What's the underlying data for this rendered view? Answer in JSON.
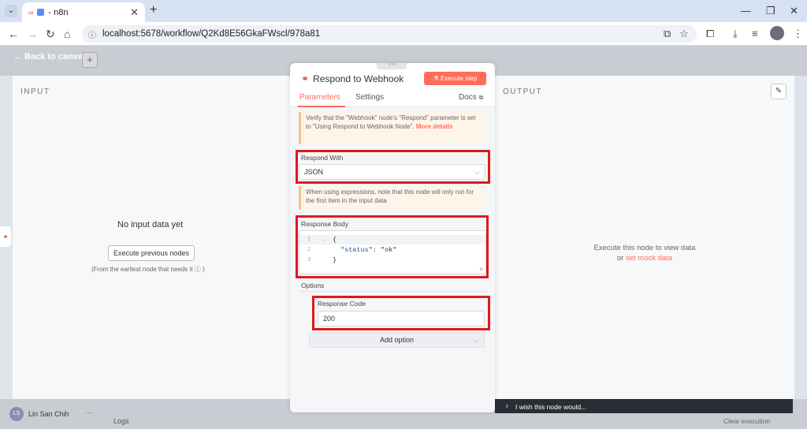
{
  "browser": {
    "tab_title": "- n8n",
    "url": "localhost:5678/workflow/Q2Kd8E56GkaFWscl/978a81"
  },
  "app": {
    "back_label": "← Back to canvas",
    "user_name": "Lin San Chih",
    "user_initials": "LS",
    "logs_label": "Logs",
    "clear_execution": "Clear execution",
    "wish_text": "I wish this node would..."
  },
  "input_pane": {
    "heading": "INPUT",
    "empty_title": "No input data yet",
    "execute_previous": "Execute previous nodes",
    "hint": "(From the earliest node that needs it ⓘ )"
  },
  "output_pane": {
    "heading": "OUTPUT",
    "message_line1": "Execute this node to view data",
    "message_or": "or",
    "mock_link": "set mock data"
  },
  "ndv": {
    "title": "Respond to Webhook",
    "execute_step": "⚗ Execute step",
    "tabs": {
      "parameters": "Parameters",
      "settings": "Settings",
      "docs": "Docs"
    },
    "notice1": "Verify that the \"Webhook\" node's \"Respond\" parameter is set to \"Using Respond to Webhook Node\".",
    "notice1_more": "More details",
    "respond_with_label": "Respond With",
    "respond_with_value": "JSON",
    "notice2": "When using expressions, note that this node will only run for the first item in the input data",
    "response_body_label": "Response Body",
    "code": {
      "line1_num": "1",
      "line1": "{",
      "line2_num": "2",
      "line2_key": "\"status\"",
      "line2_rest": ": \"ok\"",
      "line3_num": "3",
      "line3": "}"
    },
    "options_label": "Options",
    "response_code_label": "Response Code",
    "response_code_value": "200",
    "add_option": "Add option"
  },
  "colors": {
    "accent": "#ff6d5a",
    "annotation_red": "#e2181d"
  }
}
